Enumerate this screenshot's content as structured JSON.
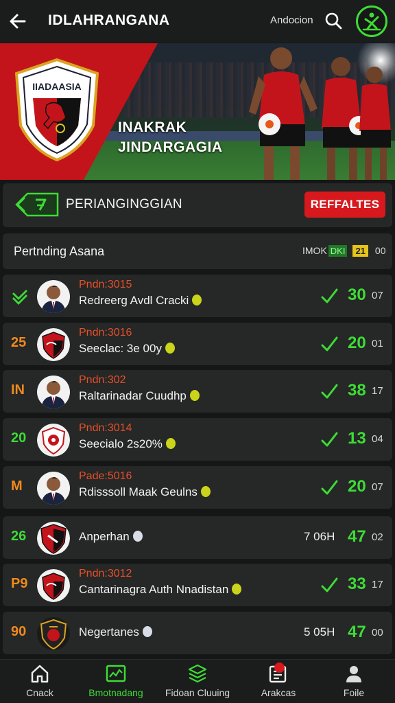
{
  "header": {
    "title": "IDLAHRANGANA",
    "link": "Andocion"
  },
  "hero": {
    "crest_text": "IIADAASIA",
    "line1": "INAKRAK",
    "line2": "JINDARGAGIA",
    "slides": 4
  },
  "section": {
    "title": "PERIANGINGGIAN",
    "button": "REFFALTES"
  },
  "table": {
    "title": "Pertnding Asana",
    "col1": "IMOK",
    "col2": "DKI",
    "col3": "21",
    "col4": "00"
  },
  "rows": [
    {
      "rank": "",
      "rank_color": "green",
      "rank_icon": "check",
      "sub": "Pndn:3015",
      "name": "Redreerg Avdl Cracki",
      "time": "",
      "score": "30",
      "extra": "07",
      "avatar": "person"
    },
    {
      "rank": "25",
      "rank_color": "orange",
      "sub": "Pndn:3016",
      "name": "Seeclac: 3e 00y",
      "time": "",
      "score": "20",
      "extra": "01",
      "avatar": "crest-red"
    },
    {
      "rank": "IN",
      "rank_color": "orange",
      "sub": "Pndn:302",
      "name": "Raltarinadar Cuudhp",
      "time": "",
      "score": "38",
      "extra": "17",
      "avatar": "person"
    },
    {
      "rank": "20",
      "rank_color": "green",
      "sub": "Pndn:3014",
      "name": "Seecialo 2s20%",
      "time": "",
      "score": "13",
      "extra": "04",
      "avatar": "crest-white"
    },
    {
      "rank": "M",
      "rank_color": "orange",
      "sub": "Pade:5016",
      "name": "Rdisssoll Maak Geulns",
      "time": "",
      "score": "20",
      "extra": "07",
      "avatar": "person"
    },
    {
      "rank": "26",
      "rank_color": "green",
      "sub": "",
      "name": "Anperhan",
      "time": "7 06H",
      "score": "47",
      "extra": "02",
      "avatar": "crest-black"
    },
    {
      "rank": "P9",
      "rank_color": "orange",
      "sub": "Pndn:3012",
      "name": "Cantarinagra Auth Nnadistan",
      "time": "",
      "score": "33",
      "extra": "17",
      "avatar": "crest-red"
    },
    {
      "rank": "90",
      "rank_color": "orange",
      "sub": "",
      "name": "Negertanes",
      "time": "5 05H",
      "score": "47",
      "extra": "00",
      "avatar": "crest-dark"
    }
  ],
  "nav": [
    {
      "label": "Cnack",
      "icon": "home-icon"
    },
    {
      "label": "Bmotnadang",
      "icon": "chart-icon",
      "active": true
    },
    {
      "label": "Fidoan Cluuing",
      "icon": "layers-icon"
    },
    {
      "label": "Arakcas",
      "icon": "list-icon",
      "badge": true
    },
    {
      "label": "Foile",
      "icon": "profile-icon"
    }
  ],
  "colors": {
    "accent_green": "#3ddc35",
    "accent_red": "#d7191e",
    "accent_orange": "#f08a1c",
    "panel": "#262727",
    "background": "#151616"
  }
}
